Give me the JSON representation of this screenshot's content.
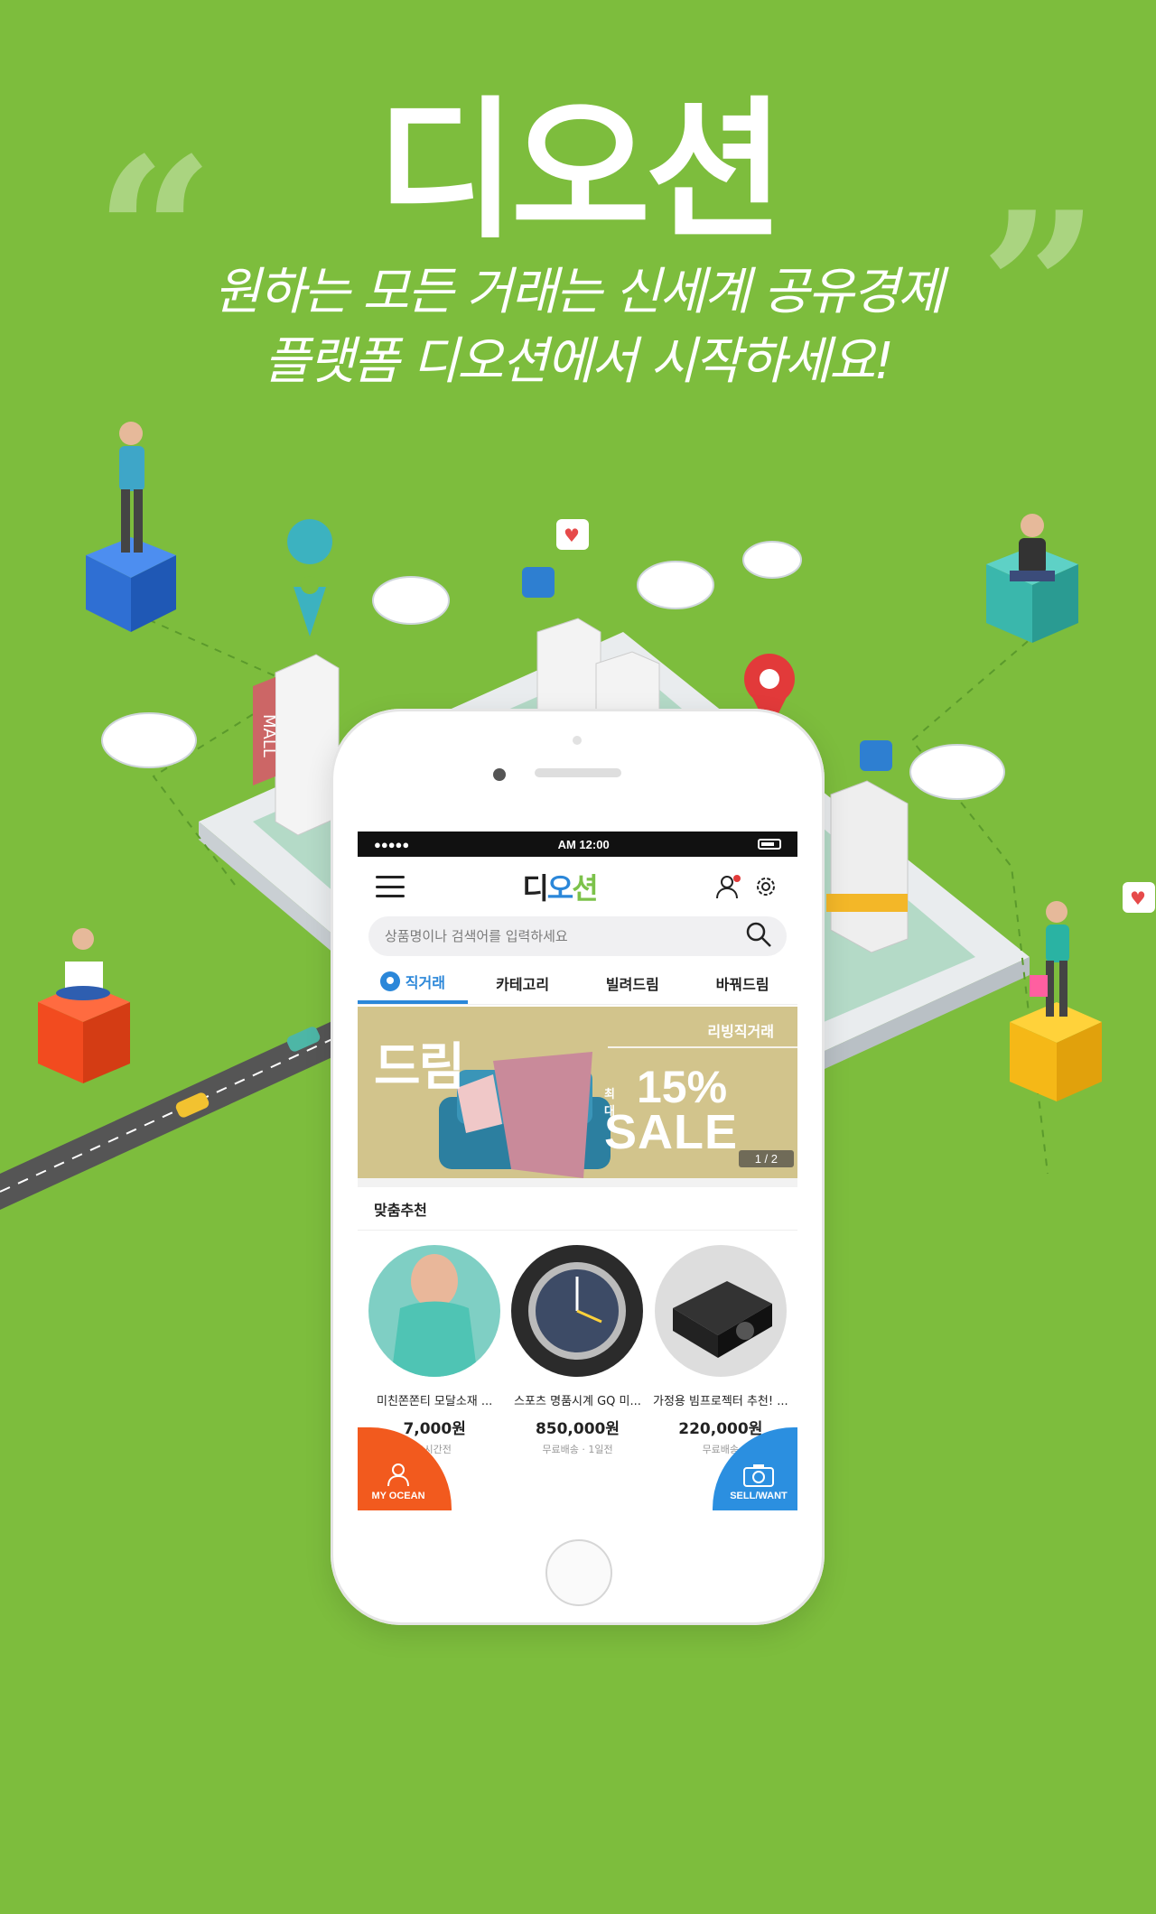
{
  "hero": {
    "title": "디오션",
    "subtitle_line1": "원하는 모든 거래는 신세계 공유경제",
    "subtitle_line2": "플랫폼 디오션에서 시작하세요!"
  },
  "illustration": {
    "mall_sign": "MALL"
  },
  "phone": {
    "statusbar": {
      "signal": "●●●●●",
      "time": "AM 12:00"
    },
    "appbar": {
      "logo_part1": "디",
      "logo_part2": "오",
      "logo_part3": "션"
    },
    "search": {
      "placeholder": "상품명이나 검색어를 입력하세요"
    },
    "tabs": [
      {
        "label": "직거래",
        "active": true
      },
      {
        "label": "카테고리",
        "active": false
      },
      {
        "label": "빌려드림",
        "active": false
      },
      {
        "label": "바꿔드림",
        "active": false
      }
    ],
    "banner": {
      "headline": "드림",
      "tag": "리빙직거래",
      "max_label": "최대",
      "percent": "15%",
      "sale": "SALE",
      "pager": "1 / 2"
    },
    "recommend": {
      "title": "맞춤추천",
      "products": [
        {
          "name": "미친쫀쫀티 모달소재 ...",
          "price": "7,000원",
          "meta": "2시간전"
        },
        {
          "name": "스포츠 명품시계 GQ 미...",
          "price": "850,000원",
          "meta": "무료배송 · 1일전"
        },
        {
          "name": "가정용 빔프로젝터 추천! ...",
          "price": "220,000원",
          "meta": "무료배송"
        }
      ]
    },
    "fab": {
      "left_label": "MY OCEAN",
      "right_label": "SELL/WANT"
    }
  },
  "colors": {
    "background": "#7dbd3d",
    "accent_blue": "#2b87d9",
    "accent_orange": "#f25a1e"
  }
}
